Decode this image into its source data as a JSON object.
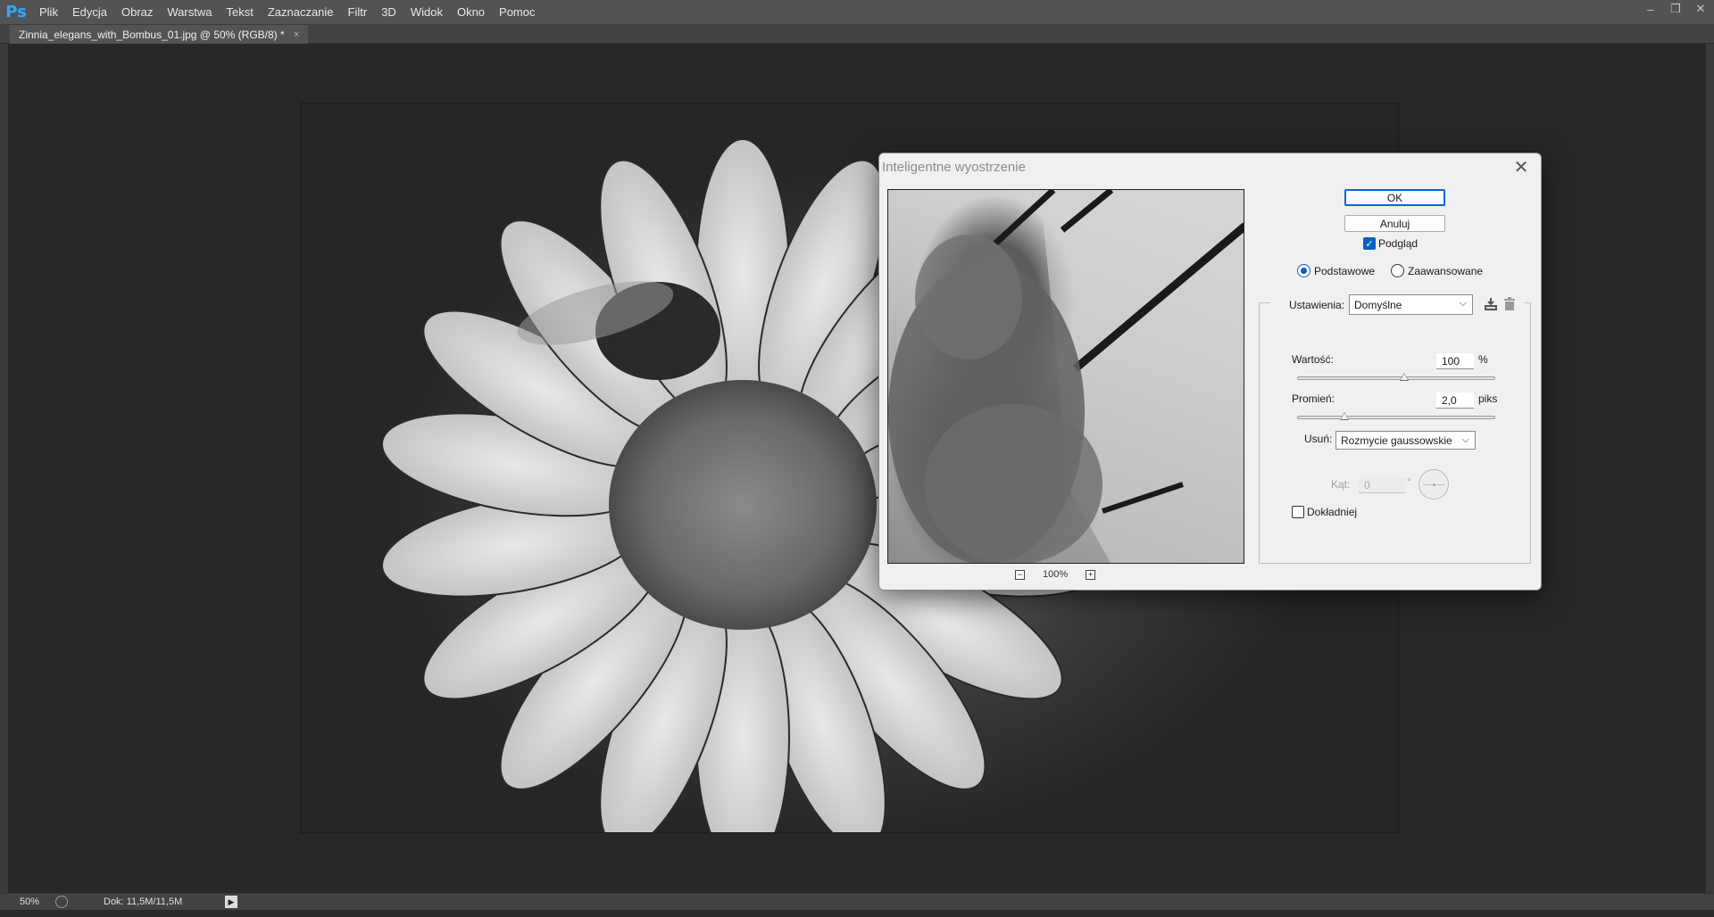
{
  "app": {
    "logo": "Ps",
    "menu": [
      "Plik",
      "Edycja",
      "Obraz",
      "Warstwa",
      "Tekst",
      "Zaznaczanie",
      "Filtr",
      "3D",
      "Widok",
      "Okno",
      "Pomoc"
    ],
    "window_controls": [
      "minimize-icon",
      "restore-icon",
      "close-icon"
    ]
  },
  "document": {
    "tab_title": "Zinnia_elegans_with_Bombus_01.jpg @ 50% (RGB/8) *",
    "tab_close": "×"
  },
  "status": {
    "zoom": "50%",
    "doc_size": "Dok: 11,5M/11,5M",
    "arrow": "▶"
  },
  "dialog": {
    "title": "Inteligentne wyostrzenie",
    "close": "✕",
    "ok_label": "OK",
    "cancel_label": "Anuluj",
    "preview_label": "Podgląd",
    "preview_checked": true,
    "preview_zoom": "100%",
    "mode_basic": "Podstawowe",
    "mode_advanced": "Zaawansowane",
    "mode_selected": "basic",
    "settings_label": "Ustawienia:",
    "settings_value": "Domyślne",
    "amount_label": "Wartość:",
    "amount_value": "100",
    "amount_unit": "%",
    "amount_slider_fraction": 0.54,
    "radius_label": "Promień:",
    "radius_value": "2,0",
    "radius_unit": "piks",
    "radius_slider_fraction": 0.24,
    "remove_label": "Usuń:",
    "remove_value": "Rozmycie gaussowskie",
    "angle_label": "Kąt:",
    "angle_value": "0",
    "angle_unit": "°",
    "more_accurate_label": "Dokładniej",
    "more_accurate_checked": false,
    "accent_color": "#0a5fc4"
  }
}
